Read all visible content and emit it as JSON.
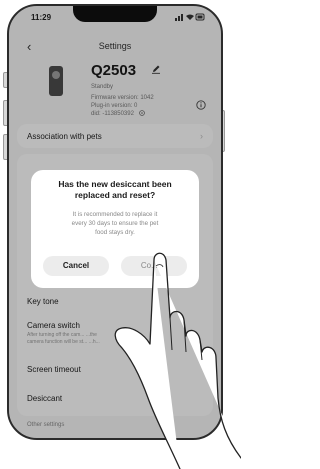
{
  "status_bar": {
    "time": "11:29"
  },
  "nav": {
    "back_icon": "chevron-left-icon",
    "title": "Settings"
  },
  "device": {
    "name": "Q2503",
    "status": "Standby",
    "firmware": "Firmware version: 1042",
    "plugin": "Plug-in version: 0",
    "did": "did: -113850392"
  },
  "rows": {
    "association": "Association with pets",
    "key_tone": "Key tone",
    "camera_switch": "Camera switch",
    "camera_desc_line1": "After turning off the cam... ...the",
    "camera_desc_line2": "camera function will be st... ...h...",
    "screen_timeout": "Screen timeout",
    "desiccant": "Desiccant",
    "other_settings": "Other settings"
  },
  "dialog": {
    "title_line1": "Has the new desiccant been",
    "title_line2": "replaced and reset?",
    "body_line1": "It is recommended to replace it",
    "body_line2": "every 30 days to ensure the pet",
    "body_line3": "food stays dry.",
    "cancel": "Cancel",
    "confirm": "Co...rm"
  }
}
